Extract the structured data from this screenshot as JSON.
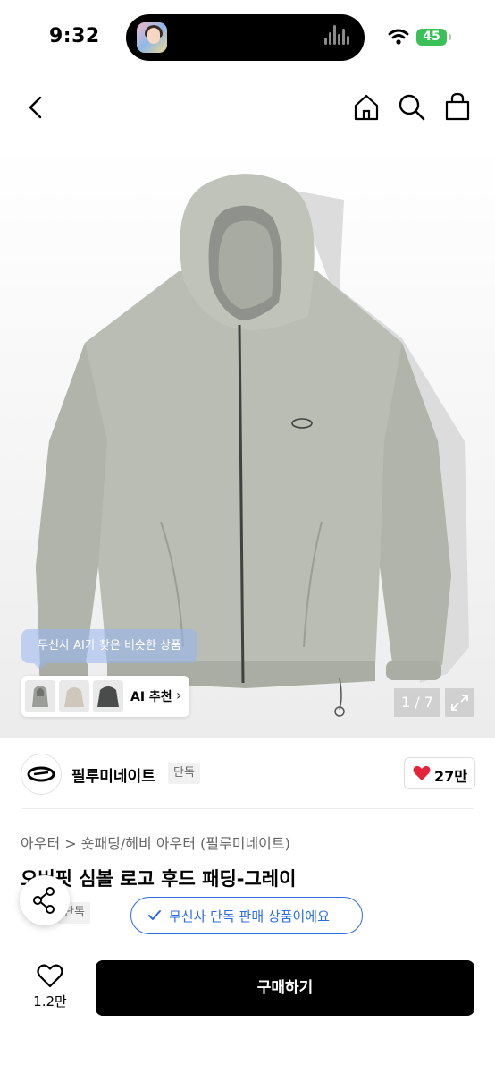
{
  "status_bar": {
    "time": "9:32",
    "battery": "45",
    "icons": [
      "wifi-icon",
      "battery-icon"
    ]
  },
  "top_nav": {
    "icons": [
      "back-icon",
      "home-icon",
      "search-icon",
      "shopping-bag-icon"
    ]
  },
  "gallery": {
    "ai_tooltip": "무신사 AI가 찾은 비슷한 상품",
    "ai_recommend_label": "AI 추천",
    "counter": "1 / 7"
  },
  "brand": {
    "name": "필루미네이트",
    "exclusive_tag": "단독",
    "like_count": "27만"
  },
  "product": {
    "breadcrumb": "아우터 > 숏패딩/헤비 아우터 (필루미네이트)",
    "title": "오버핏 심볼 로고 후드 패딩-그레이",
    "exclusive_tag": "단독",
    "exclusive_notice": "무신사 단독 판매 상품이에요"
  },
  "bottom_bar": {
    "wish_count": "1.2만",
    "buy_label": "구매하기"
  },
  "colors": {
    "primary_blue": "#2b6de6",
    "heart_red": "#e5243b",
    "buy_button": "#000000",
    "battery_green": "#3ac057"
  }
}
